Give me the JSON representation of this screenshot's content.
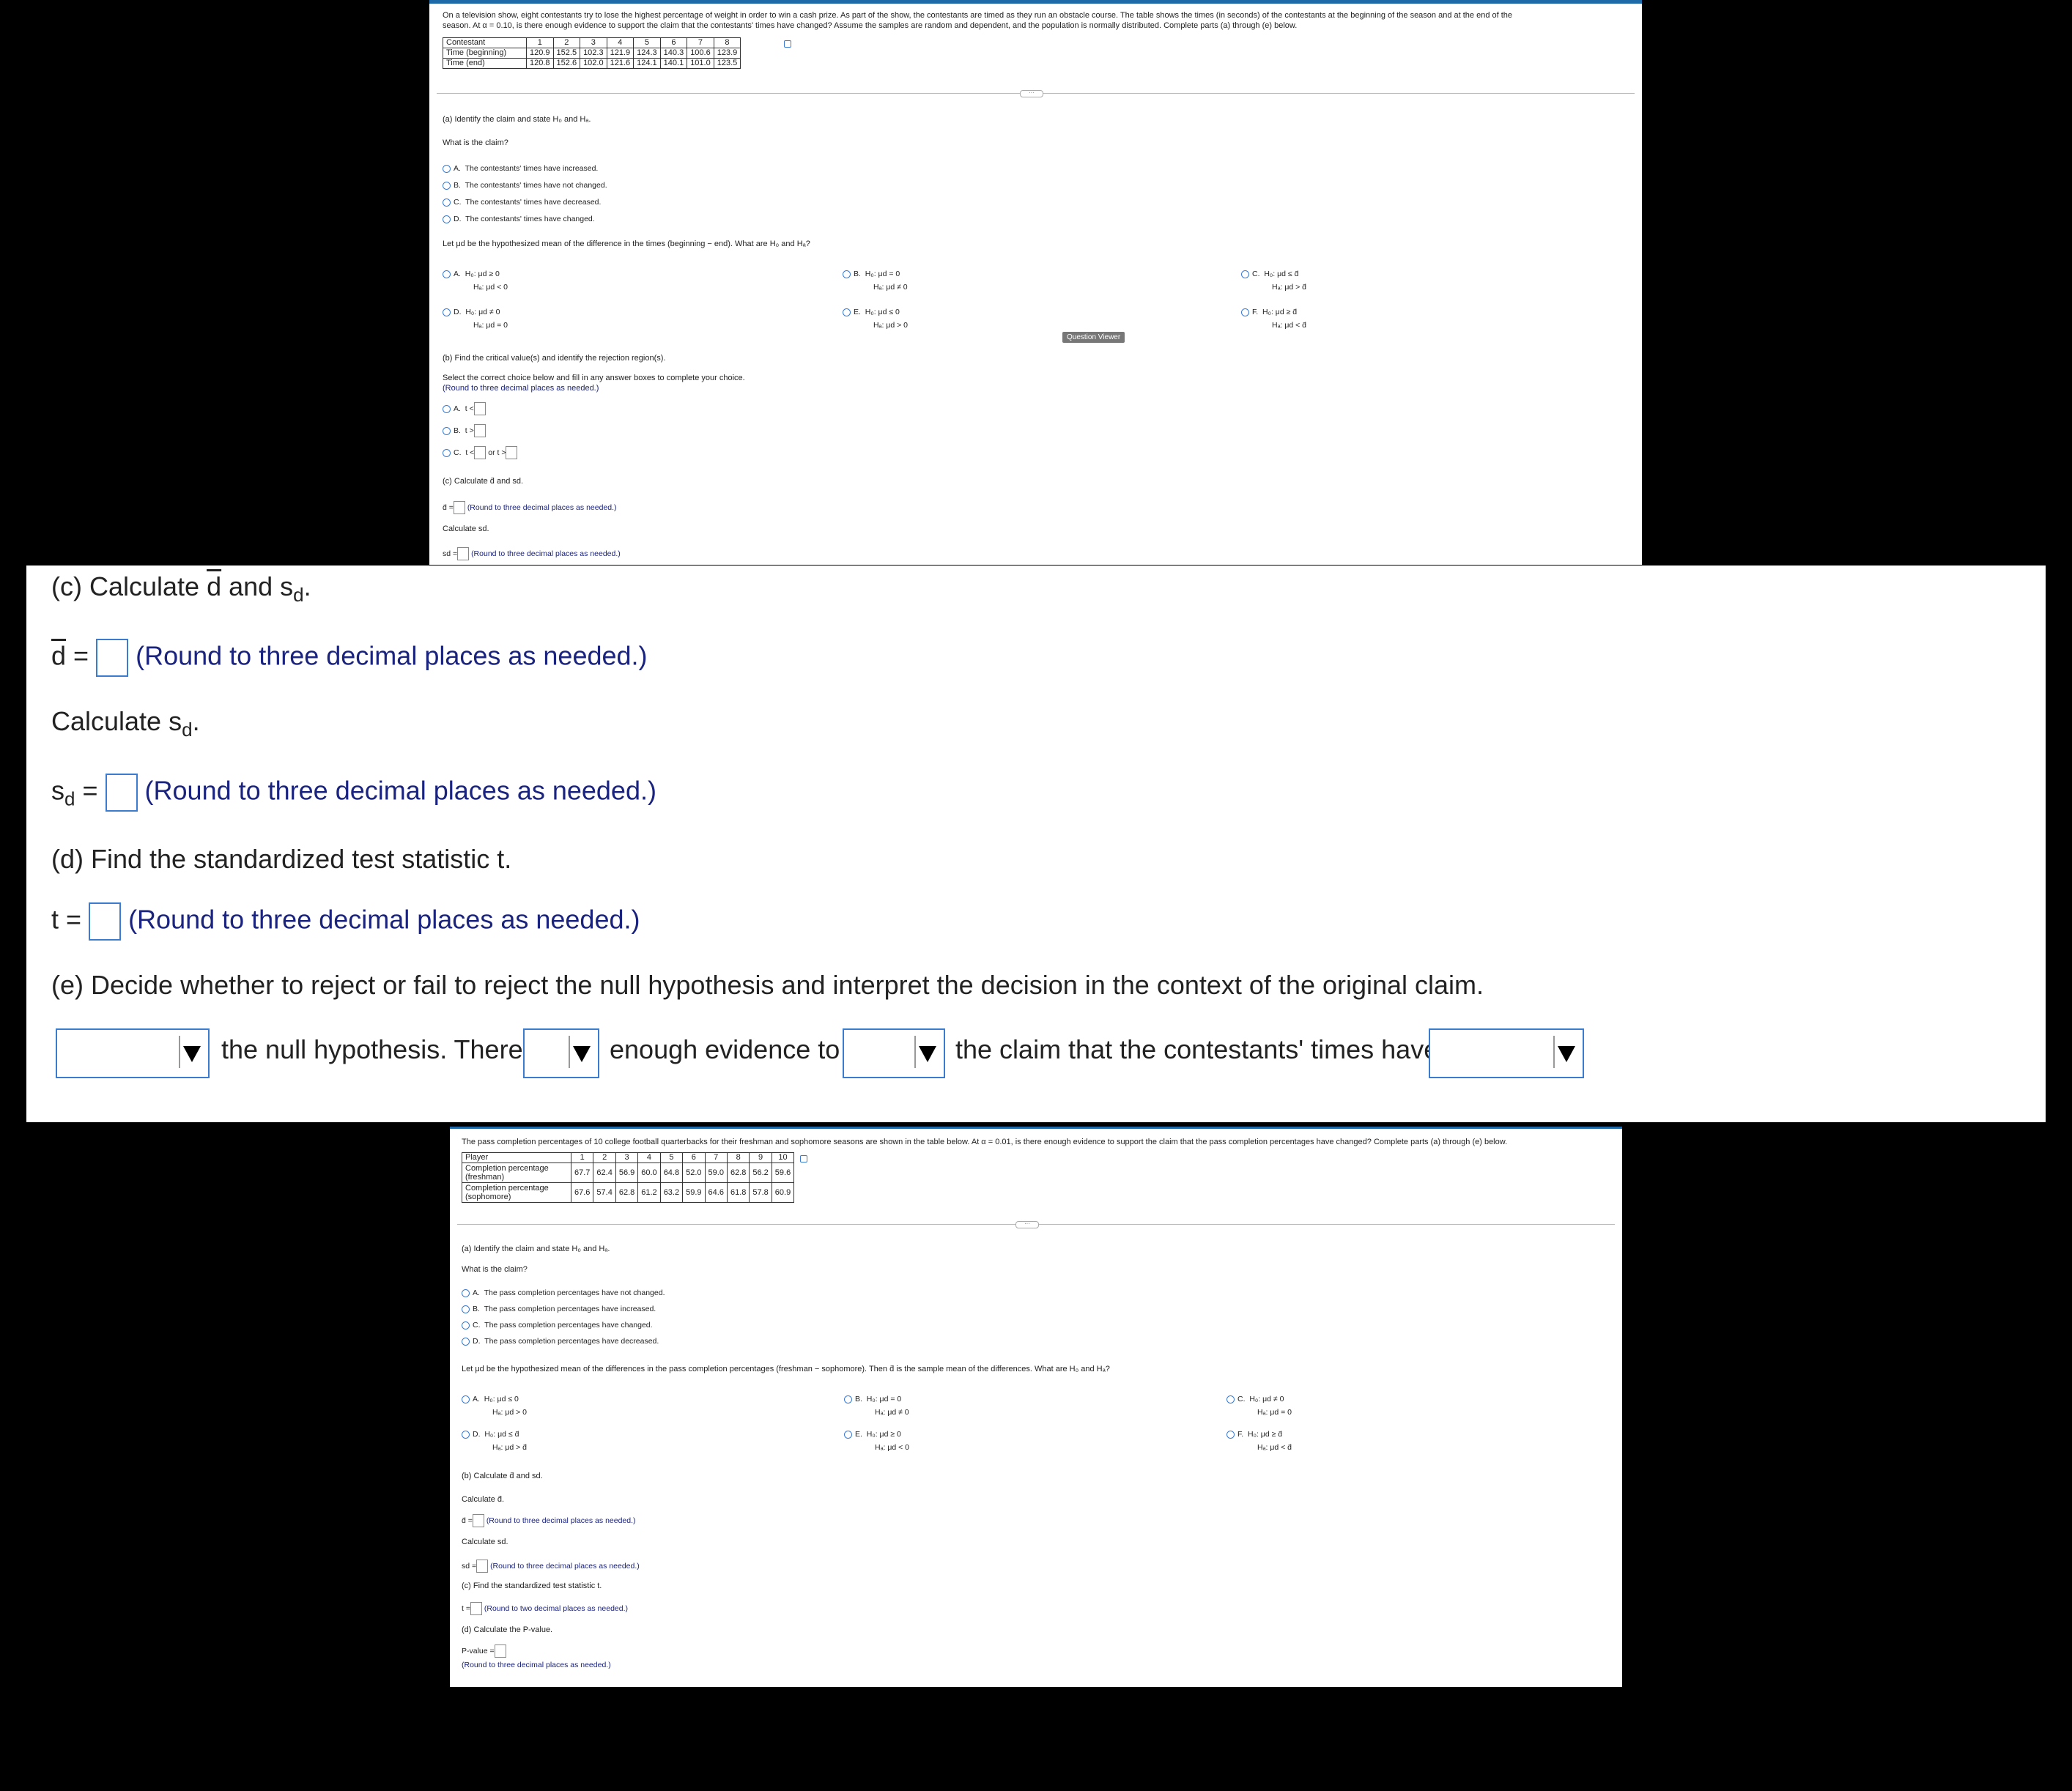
{
  "p1": {
    "intro_line1": "On a television show, eight contestants try to lose the highest percentage of weight in order to win a cash prize. As part of the show, the contestants are timed as they run an obstacle course. The table shows the times (in seconds) of the contestants at the beginning of the season and at the end of the",
    "intro_line2": "season. At α = 0.10, is there enough evidence to support the claim that the contestants' times have changed? Assume the samples are random and dependent, and the population is normally distributed. Complete parts (a) through (e) below.",
    "table": {
      "row_labels": [
        "Contestant",
        "Time (beginning)",
        "Time (end)"
      ],
      "contestants": [
        "1",
        "2",
        "3",
        "4",
        "5",
        "6",
        "7",
        "8"
      ],
      "beginning": [
        "120.9",
        "152.5",
        "102.3",
        "121.9",
        "124.3",
        "140.3",
        "100.6",
        "123.9"
      ],
      "end": [
        "120.8",
        "152.6",
        "102.0",
        "121.6",
        "124.1",
        "140.1",
        "101.0",
        "123.5"
      ]
    },
    "a_title": "(a) Identify the claim and state H₀ and Hₐ.",
    "claim_q": "What is the claim?",
    "claims": [
      {
        "letter": "A.",
        "text": "The contestants' times have increased."
      },
      {
        "letter": "B.",
        "text": "The contestants' times have not changed."
      },
      {
        "letter": "C.",
        "text": "The contestants' times have decreased."
      },
      {
        "letter": "D.",
        "text": "The contestants' times have changed."
      }
    ],
    "hyp_q": "Let μd be the hypothesized mean of the difference in the times (beginning − end). What are H₀ and Hₐ?",
    "hyps": [
      {
        "letter": "A.",
        "h0": "H₀: μd ≥ 0",
        "ha": "Hₐ: μd < 0"
      },
      {
        "letter": "B.",
        "h0": "H₀: μd = 0",
        "ha": "Hₐ: μd ≠ 0"
      },
      {
        "letter": "C.",
        "h0": "H₀: μd ≤ d̄",
        "ha": "Hₐ: μd > d̄"
      },
      {
        "letter": "D.",
        "h0": "H₀: μd ≠ 0",
        "ha": "Hₐ: μd = 0"
      },
      {
        "letter": "E.",
        "h0": "H₀: μd ≤ 0",
        "ha": "Hₐ: μd > 0"
      },
      {
        "letter": "F.",
        "h0": "H₀: μd ≥ d̄",
        "ha": "Hₐ: μd < d̄"
      }
    ],
    "question_viewer": "Question Viewer",
    "b_title": "(b) Find the critical value(s) and identify the rejection region(s).",
    "b_instr1": "Select the correct choice below and fill in any answer boxes to complete your choice.",
    "b_instr2": "(Round to three decimal places as needed.)",
    "b_opts": [
      {
        "letter": "A.",
        "pre": "t <",
        "mid": "",
        "post": ""
      },
      {
        "letter": "B.",
        "pre": "t >",
        "mid": "",
        "post": ""
      },
      {
        "letter": "C.",
        "pre": "t <",
        "mid": "or t >",
        "post": ""
      }
    ],
    "c_title": "(c) Calculate d̄ and sd.",
    "dbar_label": "d̄ =",
    "round3": "(Round to three decimal places as needed.)",
    "calc_sd": "Calculate sd.",
    "sd_label": "sd ="
  },
  "p2": {
    "c_title_pre": "(c) Calculate ",
    "c_title_d": "d",
    "c_title_and": " and s",
    "c_title_sub": "d",
    "dbar_d": "d",
    "eq": "=",
    "round3": "(Round to three decimal places as needed.)",
    "calc_sd_pre": "Calculate s",
    "calc_sd_sub": "d",
    "sd_pre": "s",
    "sd_sub": "d",
    "d_title": "(d) Find the standardized test statistic t.",
    "t_label": "t =",
    "e_title": "(e) Decide whether to reject or fail to reject the null hypothesis and interpret the decision in the context of the original claim.",
    "e_text1": "the null hypothesis. There",
    "e_text2": "enough evidence to",
    "e_text3": "the claim that the contestants' times have"
  },
  "p3": {
    "intro": "The pass completion percentages of 10 college football quarterbacks for their freshman and sophomore seasons are shown in the table below. At α = 0.01, is there enough evidence to support the claim that the pass completion percentages have changed? Complete parts (a) through (e) below.",
    "table": {
      "row_labels": [
        "Player",
        "Completion percentage (freshman)",
        "Completion percentage (sophomore)"
      ],
      "players": [
        "1",
        "2",
        "3",
        "4",
        "5",
        "6",
        "7",
        "8",
        "9",
        "10"
      ],
      "freshman": [
        "67.7",
        "62.4",
        "56.9",
        "60.0",
        "64.8",
        "52.0",
        "59.0",
        "62.8",
        "56.2",
        "59.6"
      ],
      "sophomore": [
        "67.6",
        "57.4",
        "62.8",
        "61.2",
        "63.2",
        "59.9",
        "64.6",
        "61.8",
        "57.8",
        "60.9"
      ]
    },
    "a_title": "(a) Identify the claim and state H₀ and Hₐ.",
    "claim_q": "What is the claim?",
    "claims": [
      {
        "letter": "A.",
        "text": "The pass completion percentages have not changed."
      },
      {
        "letter": "B.",
        "text": "The pass completion percentages have increased."
      },
      {
        "letter": "C.",
        "text": "The pass completion percentages have changed."
      },
      {
        "letter": "D.",
        "text": "The pass completion percentages have decreased."
      }
    ],
    "hyp_q": "Let μd be the hypothesized mean of the differences in the pass completion percentages (freshman − sophomore). Then d̄ is the sample mean of the differences. What are H₀ and Hₐ?",
    "hyps": [
      {
        "letter": "A.",
        "h0": "H₀: μd ≤ 0",
        "ha": "Hₐ: μd > 0"
      },
      {
        "letter": "B.",
        "h0": "H₀: μd = 0",
        "ha": "Hₐ: μd ≠ 0"
      },
      {
        "letter": "C.",
        "h0": "H₀: μd ≠ 0",
        "ha": "Hₐ: μd = 0"
      },
      {
        "letter": "D.",
        "h0": "H₀: μd ≤ d̄",
        "ha": "Hₐ: μd > d̄"
      },
      {
        "letter": "E.",
        "h0": "H₀: μd ≥ 0",
        "ha": "Hₐ: μd < 0"
      },
      {
        "letter": "F.",
        "h0": "H₀: μd ≥ d̄",
        "ha": "Hₐ: μd < d̄"
      }
    ],
    "b_title": "(b) Calculate d̄ and sd.",
    "calc_dbar": "Calculate d̄.",
    "dbar_label": "d̄ =",
    "round3": "(Round to three decimal places as needed.)",
    "calc_sd": "Calculate sd.",
    "sd_label": "sd =",
    "c_title": "(c) Find the standardized test statistic t.",
    "t_label": "t =",
    "round2": "(Round to two decimal places as needed.)",
    "d_title": "(d) Calculate the P-value.",
    "p_label": "P-value =",
    "p_round": "(Round to three decimal places as needed.)"
  }
}
